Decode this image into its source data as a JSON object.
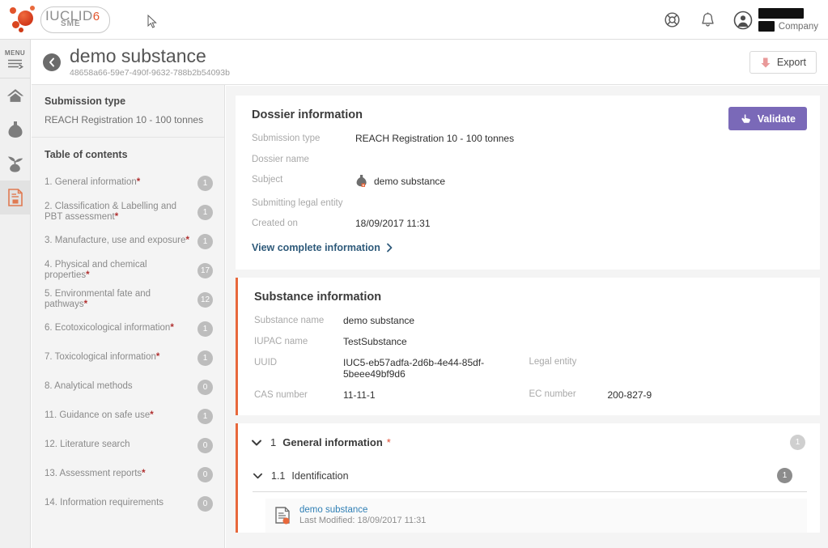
{
  "app": {
    "brand_name": "IUCLID",
    "brand_version": "6",
    "brand_edition": "SME"
  },
  "topbar": {
    "help_icon": "lifebuoy-icon",
    "notifications_icon": "bell-icon",
    "avatar_icon": "user-avatar-icon",
    "user_name": "",
    "company_label": "Company"
  },
  "rail": {
    "menu_label": "MENU",
    "items": [
      {
        "name": "home",
        "icon": "home-icon"
      },
      {
        "name": "substances",
        "icon": "flask-icon"
      },
      {
        "name": "mixtures",
        "icon": "mixture-icon"
      },
      {
        "name": "dossiers",
        "icon": "dossier-document-icon",
        "active": true
      }
    ]
  },
  "header": {
    "back_icon": "back-chevron-icon",
    "title": "demo substance",
    "subtitle": "48658a66-59e7-490f-9632-788b2b54093b",
    "export_label": "Export",
    "export_icon": "export-icon"
  },
  "sidebar": {
    "submission_type_label": "Submission type",
    "submission_type_value": "REACH Registration 10 - 100 tonnes",
    "toc_label": "Table of contents",
    "toc": [
      {
        "label": "1. General information",
        "required": true,
        "count": "1"
      },
      {
        "label": "2. Classification & Labelling and PBT assessment",
        "required": true,
        "count": "1"
      },
      {
        "label": "3. Manufacture, use and exposure",
        "required": true,
        "count": "1"
      },
      {
        "label": "4. Physical and chemical properties",
        "required": true,
        "count": "17"
      },
      {
        "label": "5. Environmental fate and pathways",
        "required": true,
        "count": "12"
      },
      {
        "label": "6. Ecotoxicological information",
        "required": true,
        "count": "1"
      },
      {
        "label": "7. Toxicological information",
        "required": true,
        "count": "1"
      },
      {
        "label": "8. Analytical methods",
        "required": false,
        "count": "0"
      },
      {
        "label": "11. Guidance on safe use",
        "required": true,
        "count": "1"
      },
      {
        "label": "12. Literature search",
        "required": false,
        "count": "0"
      },
      {
        "label": "13. Assessment reports",
        "required": true,
        "count": "0"
      },
      {
        "label": "14. Information requirements",
        "required": false,
        "count": "0"
      }
    ]
  },
  "dossier": {
    "title": "Dossier information",
    "validate_label": "Validate",
    "validate_icon": "validate-hand-icon",
    "fields": {
      "submission_type_label": "Submission type",
      "submission_type_value": "REACH Registration 10 - 100 tonnes",
      "dossier_name_label": "Dossier name",
      "dossier_name_value": "",
      "subject_label": "Subject",
      "subject_value": "demo substance",
      "subject_icon": "flask-substance-icon",
      "legal_entity_label": "Submitting legal entity",
      "legal_entity_value": "",
      "created_on_label": "Created on",
      "created_on_value": "18/09/2017 11:31"
    },
    "view_complete_label": "View complete information",
    "view_complete_icon": "chevron-right-icon"
  },
  "substance": {
    "title": "Substance information",
    "name_label": "Substance name",
    "name_value": "demo substance",
    "iupac_label": "IUPAC name",
    "iupac_value": "TestSubstance",
    "uuid_label": "UUID",
    "uuid_value": "IUC5-eb57adfa-2d6b-4e44-85df-5beee49bf9d6",
    "legal_entity_label": "Legal entity",
    "legal_entity_value": "",
    "cas_label": "CAS number",
    "cas_value": "11-11-1",
    "ec_label": "EC number",
    "ec_value": "200-827-9"
  },
  "section": {
    "number": "1",
    "name": "General information",
    "star": "*",
    "count": "1",
    "chevron_icon": "chevron-down-icon",
    "subsection": {
      "number": "1.1",
      "name": "Identification",
      "count": "1",
      "chevron_icon": "chevron-down-icon",
      "document": {
        "icon": "document-record-icon",
        "link": "demo substance",
        "meta": "Last Modified: 18/09/2017 11:31"
      }
    }
  },
  "colors": {
    "accent_orange": "#e8683c",
    "validate_purple": "#7a69b8",
    "link_blue": "#2f7fb5",
    "required_red": "#b03030",
    "panel_gray": "#f4f4f4"
  }
}
